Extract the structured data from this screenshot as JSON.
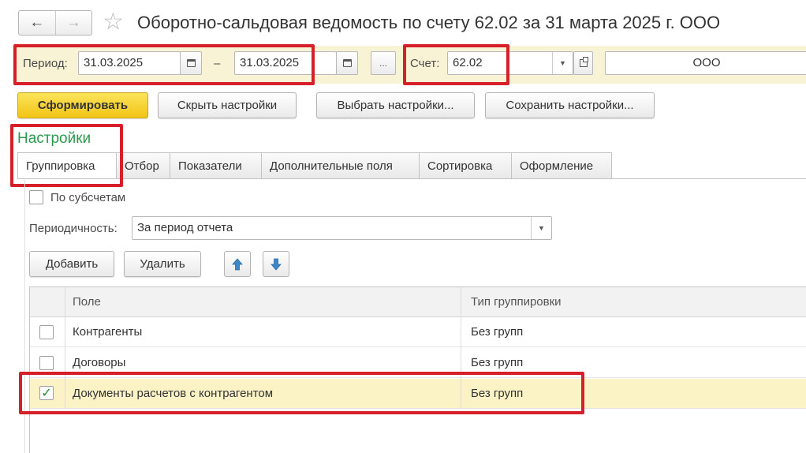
{
  "window": {
    "title": "Оборотно-сальдовая ведомость по счету 62.02 за 31 марта 2025 г. ООО"
  },
  "nav": {
    "back": "←",
    "forward": "→",
    "star": "☆"
  },
  "period": {
    "label": "Период:",
    "from": "31.03.2025",
    "separator": "–",
    "to": "31.03.2025",
    "more": "..."
  },
  "account": {
    "label": "Счет:",
    "value": "62.02"
  },
  "org": {
    "value": "ООО"
  },
  "toolbar": {
    "generate": "Сформировать",
    "hide_settings": "Скрыть настройки",
    "choose_settings": "Выбрать настройки...",
    "save_settings": "Сохранить настройки..."
  },
  "settings": {
    "title": "Настройки",
    "tabs": [
      {
        "label": "Группировка",
        "active": true
      },
      {
        "label": "Отбор"
      },
      {
        "label": "Показатели"
      },
      {
        "label": "Дополнительные поля"
      },
      {
        "label": "Сортировка"
      },
      {
        "label": "Оформление"
      }
    ],
    "by_subaccounts": "По субсчетам",
    "periodicity_label": "Периодичность:",
    "periodicity_value": "За период отчета",
    "add": "Добавить",
    "delete": "Удалить"
  },
  "grouping_table": {
    "columns": [
      "Поле",
      "Тип группировки"
    ],
    "rows": [
      {
        "field": "Контрагенты",
        "type": "Без групп",
        "checked": false
      },
      {
        "field": "Договоры",
        "type": "Без групп",
        "checked": false
      },
      {
        "field": "Документы расчетов с контрагентом",
        "type": "Без групп",
        "checked": true
      }
    ]
  },
  "colors": {
    "highlight_red": "#d71f29",
    "primary_yellow": "#f2c516",
    "settings_green": "#2a9a4f",
    "period_bar": "#f9f3d5",
    "selected_row": "#fbf2c6"
  }
}
